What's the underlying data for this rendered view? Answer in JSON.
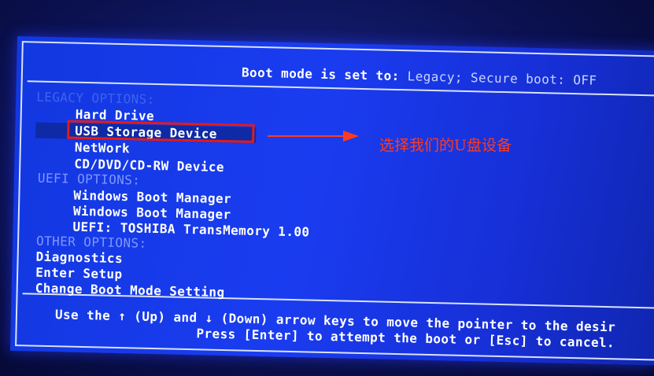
{
  "header": {
    "boot_mode_label": "Boot mode is set to:",
    "mode_value": "Legacy;",
    "secure_boot_label": "Secure boot:",
    "secure_boot_value": "OFF"
  },
  "legacy": {
    "heading": "LEGACY OPTIONS:",
    "items": [
      "Hard Drive",
      "USB Storage Device",
      "NetWork",
      "CD/DVD/CD-RW Device"
    ],
    "selected_index": 1
  },
  "uefi": {
    "heading": "UEFI OPTIONS:",
    "items": [
      "Windows Boot Manager",
      "Windows Boot Manager",
      "UEFI: TOSHIBA TransMemory 1.00"
    ]
  },
  "other": {
    "heading": "OTHER OPTIONS:",
    "items": [
      "Diagnostics",
      "Enter Setup",
      "Change Boot Mode Setting"
    ]
  },
  "footer": {
    "line1": "Use the ↑ (Up) and ↓ (Down) arrow keys to move the pointer to the desir",
    "line2": "Press [Enter] to attempt the boot or [Esc] to cancel."
  },
  "annotation": {
    "text": "选择我们的U盘设备",
    "color": "#ff3b1f"
  },
  "colors": {
    "screen_blue": "#1a3cf0",
    "text_white": "#ffffff",
    "highlight_red": "#e21b1b"
  }
}
